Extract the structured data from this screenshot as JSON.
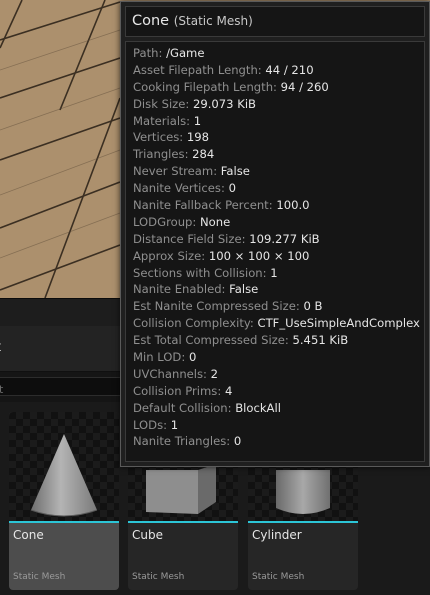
{
  "tooltip": {
    "asset_name": "Cone",
    "asset_kind": "(Static Mesh)",
    "properties": [
      {
        "key": "Path:",
        "value": "/Game"
      },
      {
        "key": "Asset Filepath Length:",
        "value": "44 / 210"
      },
      {
        "key": "Cooking Filepath Length:",
        "value": "94 / 260"
      },
      {
        "key": "Disk Size:",
        "value": "29.073 KiB"
      },
      {
        "key": "Materials:",
        "value": "1"
      },
      {
        "key": "Vertices:",
        "value": "198"
      },
      {
        "key": "Triangles:",
        "value": "284"
      },
      {
        "key": "Never Stream:",
        "value": "False"
      },
      {
        "key": "Nanite Vertices:",
        "value": "0"
      },
      {
        "key": "Nanite Fallback Percent:",
        "value": "100.0"
      },
      {
        "key": "LODGroup:",
        "value": "None"
      },
      {
        "key": "Distance Field Size:",
        "value": "109.277 KiB"
      },
      {
        "key": "Approx Size:",
        "value": "100 × 100 × 100"
      },
      {
        "key": "Sections with Collision:",
        "value": "1"
      },
      {
        "key": "Nanite Enabled:",
        "value": "False"
      },
      {
        "key": "Est Nanite Compressed Size:",
        "value": "0 B"
      },
      {
        "key": "Collision Complexity:",
        "value": "CTF_UseSimpleAndComplex"
      },
      {
        "key": "Est Total Compressed Size:",
        "value": "5.451 KiB"
      },
      {
        "key": "Min LOD:",
        "value": "0"
      },
      {
        "key": "UVChannels:",
        "value": "2"
      },
      {
        "key": "Collision Prims:",
        "value": "4"
      },
      {
        "key": "Default Collision:",
        "value": "BlockAll"
      },
      {
        "key": "LODs:",
        "value": "1"
      },
      {
        "key": "Nanite Triangles:",
        "value": "0"
      }
    ]
  },
  "panel": {
    "header_label": "t",
    "search_placeholder": "t"
  },
  "assets": [
    {
      "name": "Cone",
      "type": "Static Mesh",
      "selected": true
    },
    {
      "name": "Cube",
      "type": "Static Mesh",
      "selected": false
    },
    {
      "name": "Cylinder",
      "type": "Static Mesh",
      "selected": false
    }
  ],
  "colors": {
    "accent": "#2cc5d6",
    "floor": "#a78c6a",
    "tooltip_border": "#5a5a5a"
  }
}
